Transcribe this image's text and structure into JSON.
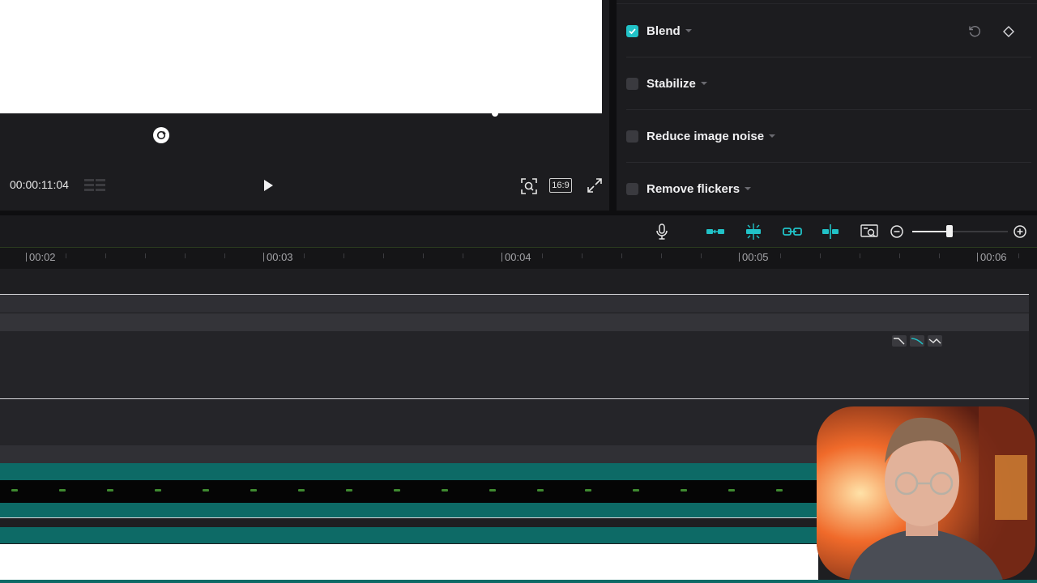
{
  "player": {
    "timecode": "00:00:11:04",
    "aspect_ratio": "16:9"
  },
  "panel": {
    "options": [
      {
        "label": "Blend",
        "checked": true
      },
      {
        "label": "Stabilize",
        "checked": false
      },
      {
        "label": "Reduce image noise",
        "checked": false
      },
      {
        "label": "Remove flickers",
        "checked": false
      }
    ]
  },
  "ruler": {
    "labels": [
      "00:02",
      "00:03",
      "00:04",
      "00:05",
      "00:06"
    ]
  },
  "colors": {
    "accent": "#21c2c7",
    "track_teal": "#0d6a66",
    "panel_bg": "#1c1c1f"
  },
  "toolbar": {
    "icons": [
      "microphone-icon",
      "link-left-icon",
      "snap-icon",
      "link-icon",
      "split-icon",
      "preview-zoom-icon",
      "zoom-out-icon",
      "zoom-in-icon"
    ],
    "zoom_level": 0.39
  }
}
